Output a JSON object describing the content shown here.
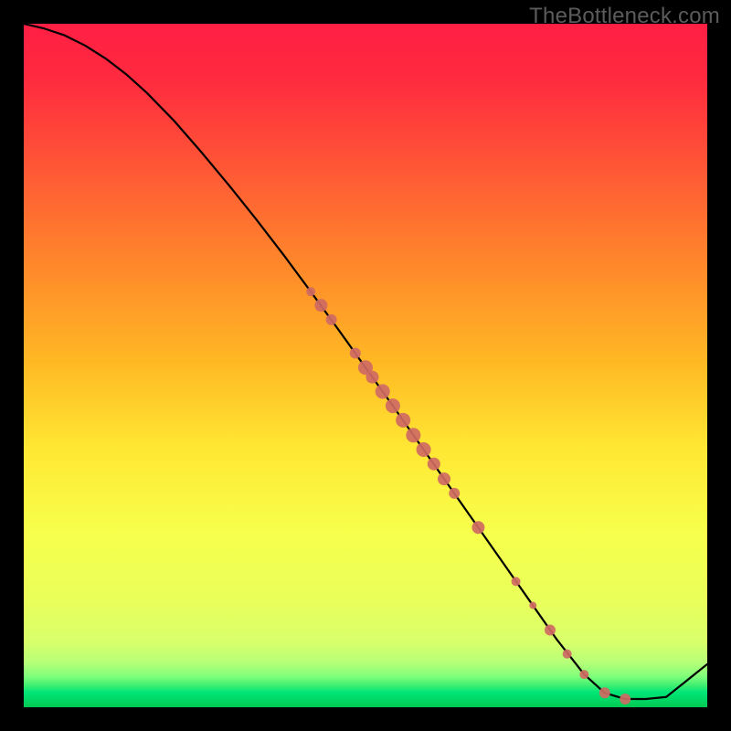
{
  "watermark": "TheBottleneck.com",
  "chart_data": {
    "type": "line",
    "title": "",
    "xlabel": "",
    "ylabel": "",
    "xlim": [
      0,
      100
    ],
    "ylim": [
      0,
      100
    ],
    "grid": false,
    "legend": false,
    "background_gradient": {
      "top": "#ff1f44",
      "mid_upper": "#ff8a2a",
      "mid": "#ffe733",
      "mid_lower": "#eaff5a",
      "green_band": "#00e676",
      "bottom": "#00c853"
    },
    "series": [
      {
        "name": "bottleneck-curve",
        "stroke": "#000000",
        "x": [
          0,
          3,
          6,
          9,
          12,
          15,
          18,
          22,
          26,
          30,
          34,
          38,
          42,
          46,
          50,
          54,
          58,
          62,
          66,
          70,
          74,
          78,
          82,
          85,
          88,
          91,
          94,
          97,
          100
        ],
        "y": [
          100,
          99.3,
          98.3,
          96.8,
          94.9,
          92.6,
          89.9,
          85.8,
          81.2,
          76.4,
          71.4,
          66.2,
          60.8,
          55.3,
          49.7,
          44.1,
          38.4,
          32.7,
          27.0,
          21.3,
          15.6,
          9.9,
          4.8,
          2.1,
          1.2,
          1.2,
          1.5,
          3.9,
          6.3
        ]
      }
    ],
    "markers": {
      "name": "data-points",
      "fill": "#cf6a63",
      "stroke": "#cf6a63",
      "points": [
        {
          "x": 42.0,
          "y": 60.8,
          "r": 5
        },
        {
          "x": 43.5,
          "y": 58.8,
          "r": 7
        },
        {
          "x": 45.0,
          "y": 56.7,
          "r": 6
        },
        {
          "x": 48.5,
          "y": 51.8,
          "r": 6
        },
        {
          "x": 50.0,
          "y": 49.7,
          "r": 8
        },
        {
          "x": 51.0,
          "y": 48.3,
          "r": 7
        },
        {
          "x": 52.5,
          "y": 46.2,
          "r": 8
        },
        {
          "x": 54.0,
          "y": 44.1,
          "r": 8
        },
        {
          "x": 55.5,
          "y": 42.0,
          "r": 8
        },
        {
          "x": 57.0,
          "y": 39.8,
          "r": 8
        },
        {
          "x": 58.5,
          "y": 37.7,
          "r": 8
        },
        {
          "x": 60.0,
          "y": 35.6,
          "r": 7
        },
        {
          "x": 61.5,
          "y": 33.4,
          "r": 7
        },
        {
          "x": 63.0,
          "y": 31.3,
          "r": 6
        },
        {
          "x": 66.5,
          "y": 26.3,
          "r": 7
        },
        {
          "x": 72.0,
          "y": 18.4,
          "r": 5
        },
        {
          "x": 74.5,
          "y": 14.9,
          "r": 4
        },
        {
          "x": 77.0,
          "y": 11.3,
          "r": 6
        },
        {
          "x": 79.5,
          "y": 7.8,
          "r": 5
        },
        {
          "x": 82.0,
          "y": 4.8,
          "r": 5
        },
        {
          "x": 85.0,
          "y": 2.1,
          "r": 6
        },
        {
          "x": 88.0,
          "y": 1.2,
          "r": 6
        }
      ]
    }
  }
}
